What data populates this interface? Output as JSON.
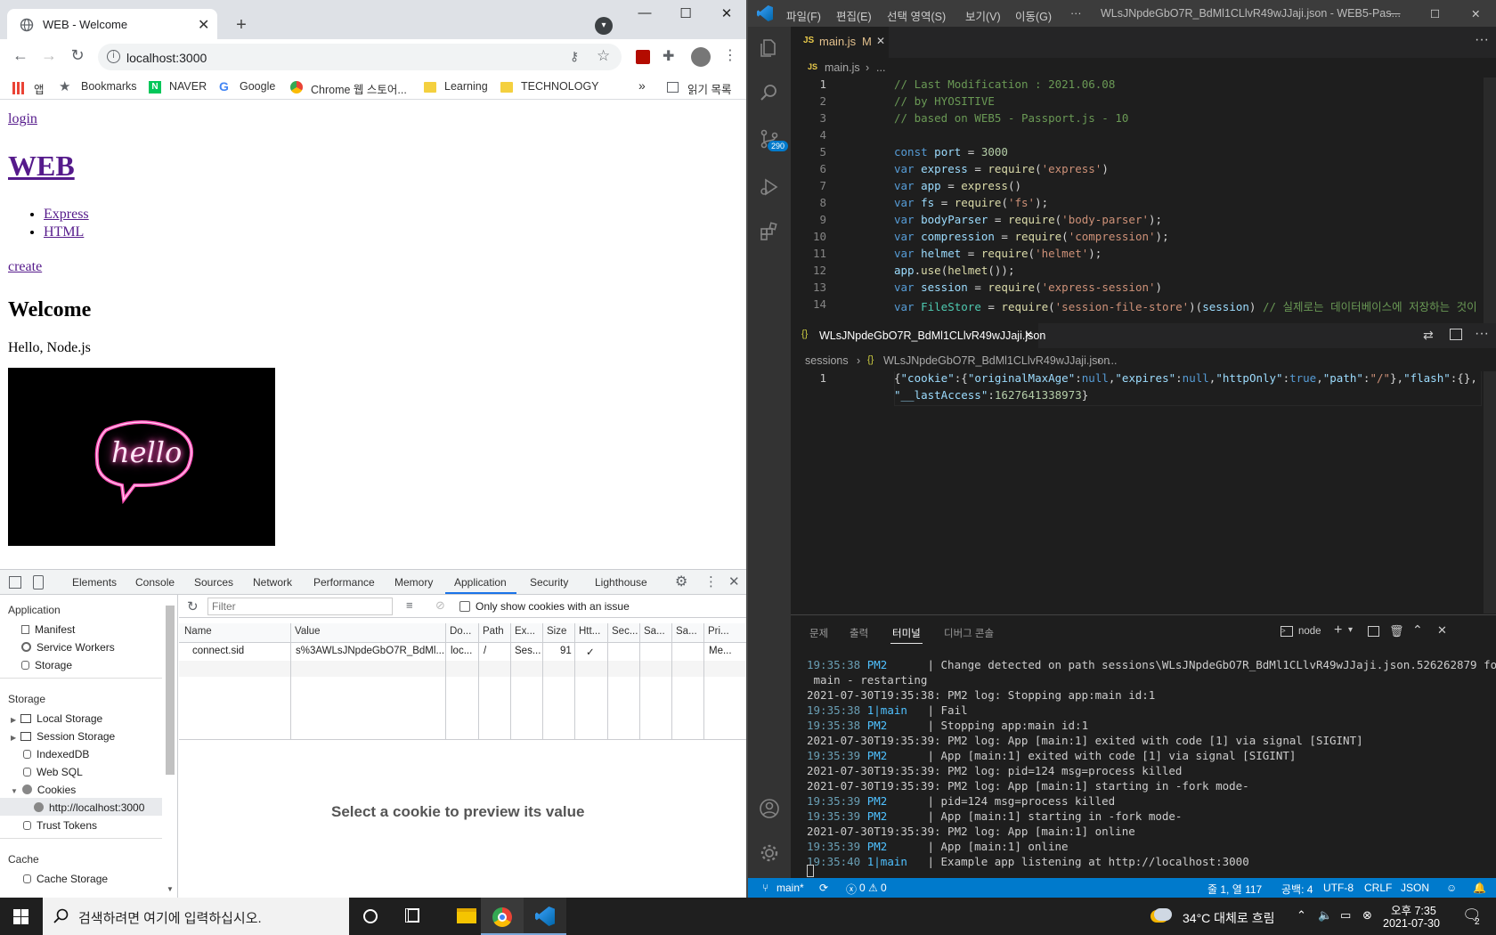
{
  "chrome": {
    "tab_title": "WEB - Welcome",
    "url": "localhost:3000",
    "bookmarks": [
      "앱",
      "Bookmarks",
      "NAVER",
      "Google",
      "Chrome 웹 스토어...",
      "Learning",
      "TECHNOLOGY"
    ],
    "reading_list": "읽기 목록"
  },
  "page": {
    "login": "login",
    "heading": "WEB",
    "links": [
      "Express",
      "HTML"
    ],
    "create": "create",
    "welcome": "Welcome",
    "hello": "Hello, Node.js",
    "neon": "hello"
  },
  "devtools": {
    "tabs": [
      "Elements",
      "Console",
      "Sources",
      "Network",
      "Performance",
      "Memory",
      "Application",
      "Security",
      "Lighthouse"
    ],
    "active_tab": "Application",
    "sidebar": {
      "application_header": "Application",
      "application_items": [
        "Manifest",
        "Service Workers",
        "Storage"
      ],
      "storage_header": "Storage",
      "storage_items": [
        "Local Storage",
        "Session Storage",
        "IndexedDB",
        "Web SQL",
        "Cookies",
        "http://localhost:3000",
        "Trust Tokens"
      ],
      "cache_header": "Cache",
      "cache_items": [
        "Cache Storage"
      ]
    },
    "filter_placeholder": "Filter",
    "only_issue_label": "Only show cookies with an issue",
    "columns": [
      "Name",
      "Value",
      "Do...",
      "Path",
      "Ex...",
      "Size",
      "Htt...",
      "Sec...",
      "Sa...",
      "Sa...",
      "Pri..."
    ],
    "cookie_row": [
      "connect.sid",
      "s%3AWLsJNpdeGbO7R_BdMl...",
      "loc...",
      "/",
      "Ses...",
      "91",
      "✓",
      "",
      "",
      "",
      "Me..."
    ],
    "preview_msg": "Select a cookie to preview its value"
  },
  "vscode": {
    "menus": [
      "파일(F)",
      "편집(E)",
      "선택 영역(S)",
      "보기(V)",
      "이동(G)",
      "···"
    ],
    "title": "WLsJNpdeGbO7R_BdMl1CLlvR49wJJaji.json - WEB5-Pas...",
    "scm_badge": "290",
    "editor1": {
      "tab": "main.js",
      "tab_status": "M",
      "breadcrumb": [
        "main.js",
        "..."
      ],
      "line_numbers": [
        "1",
        "2",
        "3",
        "4",
        "5",
        "6",
        "7",
        "8",
        "9",
        "10",
        "11",
        "12",
        "13",
        "14"
      ]
    },
    "editor2": {
      "tab": "WLsJNpdeGbO7R_BdMl1CLlvR49wJJaji.json",
      "breadcrumb": [
        "sessions",
        "WLsJNpdeGbO7R_BdMl1CLlvR49wJJaji.json",
        "..."
      ],
      "line_numbers": [
        "1"
      ]
    },
    "panel_tabs": [
      "문제",
      "출력",
      "터미널",
      "디버그 콘솔"
    ],
    "active_panel": "터미널",
    "terminal_name": "node",
    "statusbar": {
      "branch": "main*",
      "errors": "0",
      "warnings": "0",
      "position": "줄 1, 열 117",
      "spaces": "공백: 4",
      "encoding": "UTF-8",
      "eol": "CRLF",
      "language": "JSON"
    }
  },
  "taskbar": {
    "search_placeholder": "검색하려면 여기에 입력하십시오.",
    "weather": "34°C  대체로 흐림",
    "time": "오후 7:35",
    "date": "2021-07-30",
    "notif_count": "2"
  },
  "colors": {
    "vscode_blue": "#007acc",
    "link_visited": "#551a8b",
    "neon_pink": "#ff4fb8"
  }
}
